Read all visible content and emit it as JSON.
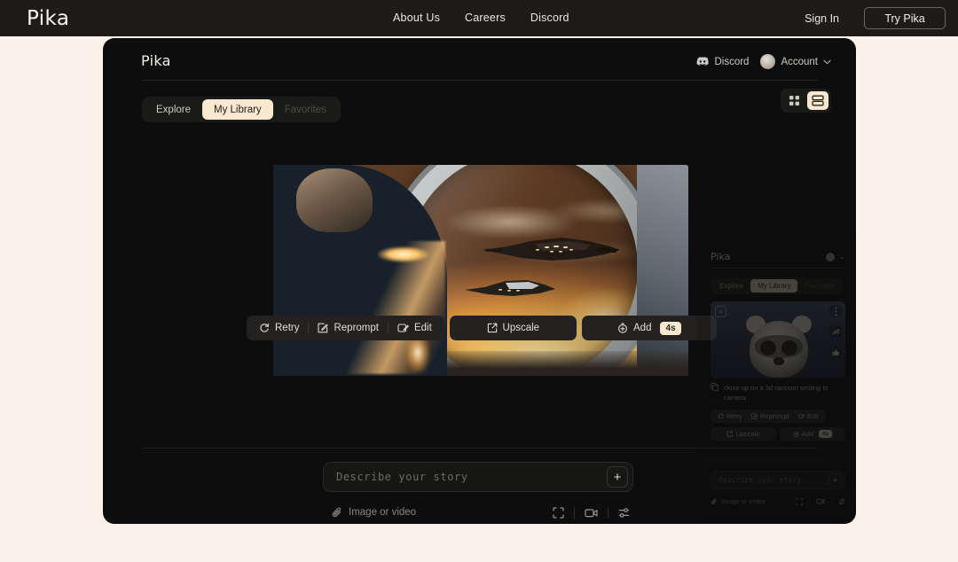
{
  "colors": {
    "page_bg": "#fdf2e9",
    "nav_bg": "#1d1c1b",
    "card_bg": "#0d0d0d",
    "accent_cream": "#f7e8cf",
    "text_light": "#e9e6e2",
    "text_muted": "#8b8782"
  },
  "topnav": {
    "brand": "Pika",
    "links": [
      {
        "label": "About Us"
      },
      {
        "label": "Careers"
      },
      {
        "label": "Discord"
      }
    ],
    "sign_in": "Sign In",
    "cta": "Try Pika"
  },
  "app": {
    "brand": "Pika",
    "header": {
      "discord_label": "Discord",
      "discord_icon": "discord-icon",
      "account_label": "Account",
      "avatar_icon": "avatar",
      "chevron_icon": "chevron-down-icon"
    },
    "tabs": [
      {
        "label": "Explore",
        "state": "inactive"
      },
      {
        "label": "My Library",
        "state": "active"
      },
      {
        "label": "Favorites",
        "state": "disabled"
      }
    ],
    "view_toggle": [
      {
        "icon": "grid-view-icon",
        "state": "inactive"
      },
      {
        "icon": "list-view-icon",
        "state": "active"
      }
    ],
    "toolbar": {
      "retry": "Retry",
      "retry_icon": "refresh-icon",
      "reprompt": "Reprompt",
      "reprompt_icon": "edit-square-icon",
      "edit": "Edit",
      "edit_icon": "image-edit-icon",
      "upscale": "Upscale",
      "upscale_icon": "expand-arrow-icon",
      "add": "Add",
      "add_icon": "stopwatch-icon",
      "add_badge": "4s"
    },
    "prompt": {
      "placeholder": "Describe your story",
      "value": "",
      "plus_label": "+",
      "attach_label": "Image or video",
      "attach_icon": "paperclip-icon",
      "foot_icons": [
        {
          "icon": "aspect-ratio-icon"
        },
        {
          "icon": "video-camera-icon"
        },
        {
          "icon": "settings-sliders-icon"
        }
      ]
    }
  },
  "ghost_panel": {
    "brand": "Pika",
    "account_icon": "avatar",
    "chevron_icon": "chevron-down-icon",
    "tabs": [
      {
        "label": "Explore",
        "state": "inactive"
      },
      {
        "label": "My Library",
        "state": "active"
      },
      {
        "label": "Favorites",
        "state": "disabled"
      }
    ],
    "card": {
      "caption": "close up on a 3d raccoon smiling to camera",
      "copy_icon": "copy-icon",
      "play_icon": "play-badge-icon",
      "more_icon": "more-options-icon",
      "share_icon": "share-icon",
      "like_icon": "thumbs-up-icon"
    },
    "toolbar": {
      "retry": "Retry",
      "reprompt": "Reprompt",
      "edit": "Edit",
      "upscale": "Upscale",
      "add": "Add",
      "add_badge": "4s"
    },
    "prompt": {
      "placeholder": "Describe your story",
      "plus_label": "+",
      "attach_label": "Image or video"
    }
  }
}
